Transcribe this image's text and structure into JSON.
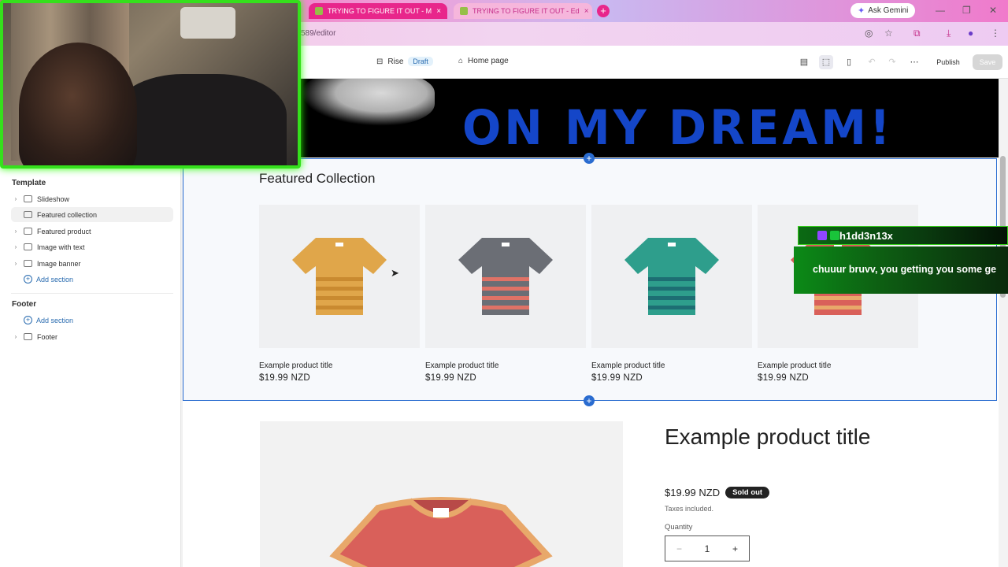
{
  "browser": {
    "tabs": [
      {
        "label": "TRYING TO FIGURE IT OUT - M",
        "close": "×"
      },
      {
        "label": "TRYING TO FIGURE IT OUT - Ed",
        "close": "×"
      }
    ],
    "new_tab": "+",
    "ask_gemini": "Ask Gemini",
    "url": "589/editor",
    "win_min": "—",
    "win_max": "❐",
    "win_close": "✕"
  },
  "editor": {
    "theme_name": "Rise",
    "theme_status": "Draft",
    "page": "Home page",
    "publish": "Publish",
    "save": "Save",
    "more": "⋯"
  },
  "sidebar": {
    "template_heading": "Template",
    "template_items": [
      {
        "label": "Slideshow"
      },
      {
        "label": "Featured collection"
      },
      {
        "label": "Featured product"
      },
      {
        "label": "Image with text"
      },
      {
        "label": "Image banner"
      }
    ],
    "add_section": "Add section",
    "footer_heading": "Footer",
    "footer_add_section": "Add section",
    "footer_item": "Footer"
  },
  "canvas": {
    "hero_text": "ON MY DREAM!",
    "featured_title": "Featured Collection",
    "products": [
      {
        "title": "Example product title",
        "price": "$19.99 NZD",
        "color": "#e0a64a",
        "stripe": "#c98a30"
      },
      {
        "title": "Example product title",
        "price": "$19.99 NZD",
        "color": "#6b6e75",
        "stripe": "#e07266"
      },
      {
        "title": "Example product title",
        "price": "$19.99 NZD",
        "color": "#2e9e8c",
        "stripe": "#1d6e73"
      },
      {
        "title": "Example product title",
        "price": "$19.99 NZD",
        "color": "#d9605a",
        "stripe": "#e8a86a"
      }
    ],
    "featured_product": {
      "title": "Example product title",
      "price": "$19.99 NZD",
      "badge": "Sold out",
      "tax_note": "Taxes included.",
      "quantity_label": "Quantity",
      "quantity": "1",
      "minus": "−",
      "plus": "+"
    }
  },
  "chat": {
    "username": "h1dd3n13x",
    "message": "chuuur bruvv, you getting you some ge"
  }
}
